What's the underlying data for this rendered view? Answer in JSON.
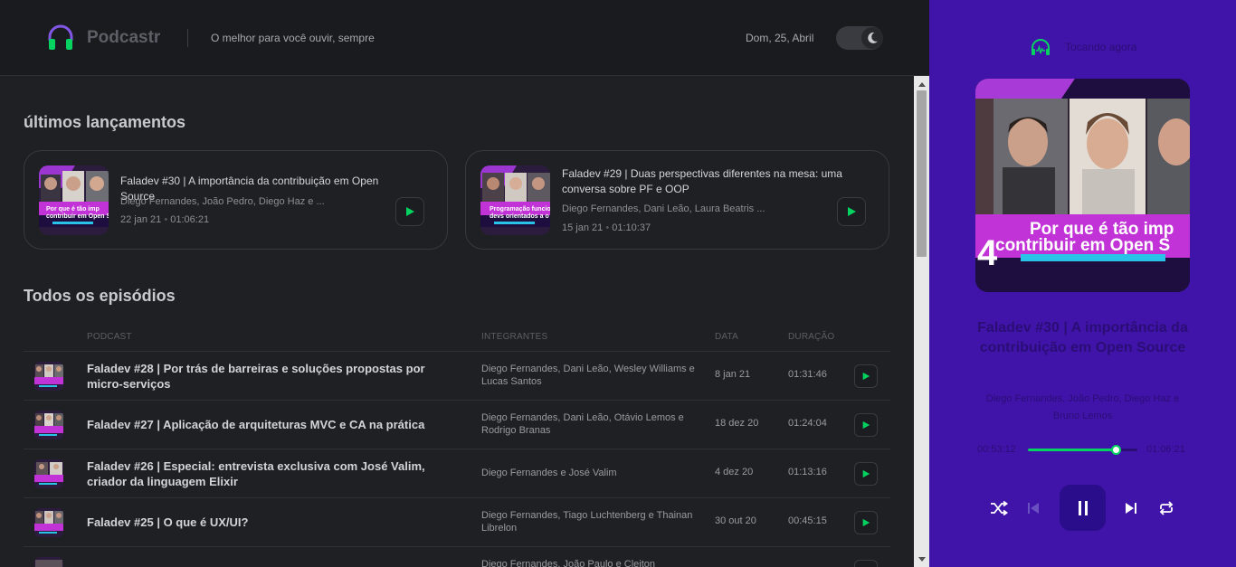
{
  "header": {
    "app_name": "Podcastr",
    "tagline": "O melhor para você ouvir, sempre",
    "date": "Dom, 25, Abril"
  },
  "latest": {
    "title": "últimos lançamentos",
    "episodes": [
      {
        "title": "Faladev #30 | A importância da contribuição em Open Source",
        "members": "Diego Fernandes, João Pedro, Diego Haz e ...",
        "date": "22 jan 21",
        "duration": "01:06:21",
        "thumb_text": "Por que é tão imp contribuir em Open S"
      },
      {
        "title": "Faladev #29 | Duas perspectivas diferentes na mesa: uma conversa sobre PF e OOP",
        "members": "Diego Fernandes, Dani Leão, Laura Beatris ...",
        "date": "15 jan 21",
        "duration": "01:10:37",
        "thumb_text": "Programação funcion devs orientados a o"
      }
    ]
  },
  "all": {
    "title": "Todos os episódios",
    "columns": [
      "PODCAST",
      "INTEGRANTES",
      "DATA",
      "DURAÇÃO"
    ],
    "rows": [
      {
        "title": "Faladev #28 | Por trás de barreiras e soluções propostas por micro-serviços",
        "members": "Diego Fernandes, Dani Leão, Wesley Williams e Lucas Santos",
        "date": "8 jan 21",
        "duration": "01:31:46"
      },
      {
        "title": "Faladev #27 | Aplicação de arquiteturas MVC e CA na prática",
        "members": "Diego Fernandes, Dani Leão, Otávio Lemos e Rodrigo Branas",
        "date": "18 dez 20",
        "duration": "01:24:04"
      },
      {
        "title": "Faladev #26 | Especial: entrevista exclusiva com José Valim, criador da linguagem Elixir",
        "members": "Diego Fernandes e José Valim",
        "date": "4 dez 20",
        "duration": "01:13:16"
      },
      {
        "title": "Faladev #25 | O que é UX/UI?",
        "members": "Diego Fernandes, Tiago Luchtenberg e Thainan Librelon",
        "date": "30 out 20",
        "duration": "00:45:15"
      },
      {
        "title": "",
        "members": "Diego Fernandes, João Paulo e Cleiton",
        "date": "",
        "duration": ""
      }
    ]
  },
  "player": {
    "label": "Tocando agora",
    "title": "Faladev #30 | A importância da contribuição em Open Source",
    "members": "Diego Fernandes, João Pedro, Diego Haz e Bruno Lemos",
    "current_time": "00:53:12",
    "total_time": "01:06:21",
    "progress": 0.8,
    "cover_text_line1": "Por que é tão imp",
    "cover_text_line2": "contribuir em Open S",
    "cover_badge": "4"
  },
  "colors": {
    "accent_green": "#04d361",
    "player_bg": "#4114a9",
    "app_bg": "#1f2023"
  }
}
